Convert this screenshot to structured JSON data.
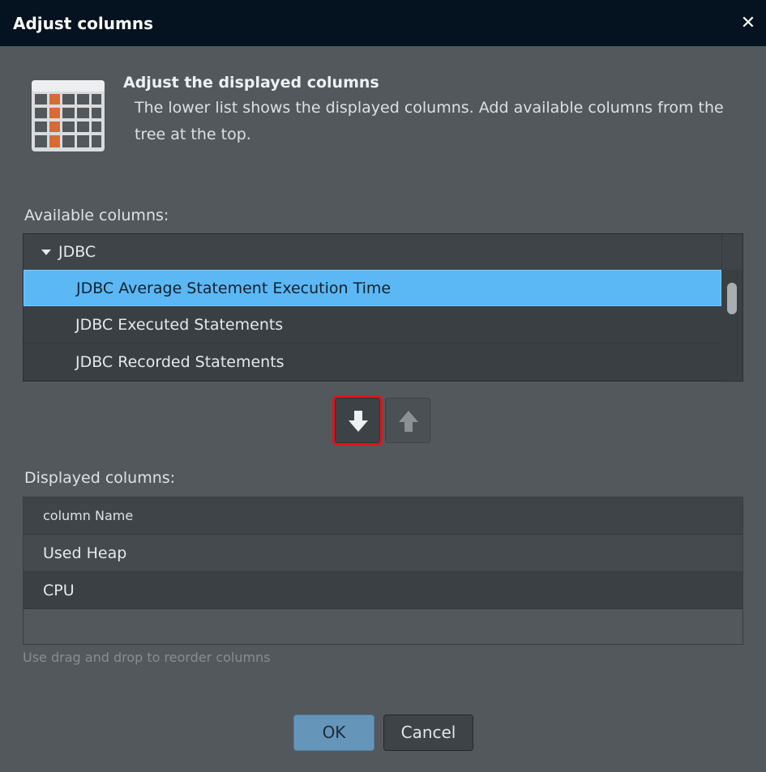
{
  "window": {
    "title": "Adjust columns",
    "close_icon": "close-icon"
  },
  "header": {
    "icon": "table-columns-icon",
    "title": "Adjust the displayed columns",
    "description": "The lower list shows the displayed columns. Add available columns from the tree at the top."
  },
  "available": {
    "label": "Available columns:",
    "group": {
      "label": "JDBC",
      "expanded": true
    },
    "items": [
      {
        "label": "JDBC Average Statement Execution Time",
        "selected": true
      },
      {
        "label": "JDBC Executed Statements",
        "selected": false
      },
      {
        "label": "JDBC Recorded Statements",
        "selected": false
      }
    ]
  },
  "move_buttons": {
    "down_icon": "arrow-down-icon",
    "up_icon": "arrow-up-icon"
  },
  "displayed": {
    "label": "Displayed columns:",
    "column_header": "column Name",
    "rows": [
      "Used Heap",
      "CPU"
    ],
    "hint": "Use drag and drop to reorder columns"
  },
  "footer": {
    "ok_label": "OK",
    "cancel_label": "Cancel"
  },
  "colors": {
    "titlebar": "#05121f",
    "background": "#52585c",
    "selection": "#5cb8f5",
    "highlight_outline": "#e0141c",
    "icon_orange": "#d86a33",
    "ok_button": "#6596ba"
  }
}
